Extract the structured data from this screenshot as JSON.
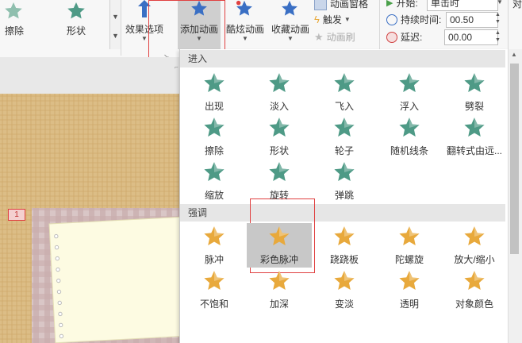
{
  "ribbon": {
    "wipe_label": "擦除",
    "shape_label": "形状",
    "effect_options_label": "效果选项",
    "add_animation_label": "添加动画",
    "cool_animation_label": "酷炫动画",
    "favorite_animation_label": "收藏动画",
    "animation_pane_label": "动画窗格",
    "trigger_label": "触发",
    "animation_painter_label": "动画刷",
    "start_label": "开始:",
    "start_value": "单击时",
    "duration_label": "持续时间:",
    "duration_value": "00.50",
    "delay_label": "延迟:",
    "delay_value": "00.00",
    "cut_label": "对"
  },
  "slide": {
    "number": "1"
  },
  "panel": {
    "entrance_header": "进入",
    "emphasis_header": "强调",
    "entrance": [
      {
        "label": "出现",
        "icon": "appear-star-icon"
      },
      {
        "label": "淡入",
        "icon": "fade-star-icon"
      },
      {
        "label": "飞入",
        "icon": "fly-in-star-icon"
      },
      {
        "label": "浮入",
        "icon": "float-in-star-icon"
      },
      {
        "label": "劈裂",
        "icon": "split-star-icon"
      },
      {
        "label": "擦除",
        "icon": "wipe-star-icon"
      },
      {
        "label": "形状",
        "icon": "shape-star-icon"
      },
      {
        "label": "轮子",
        "icon": "wheel-star-icon"
      },
      {
        "label": "随机线条",
        "icon": "random-bars-star-icon"
      },
      {
        "label": "翻转式由远...",
        "icon": "grow-turn-star-icon"
      },
      {
        "label": "缩放",
        "icon": "zoom-star-icon"
      },
      {
        "label": "旋转",
        "icon": "swivel-star-icon"
      },
      {
        "label": "弹跳",
        "icon": "bounce-star-icon"
      }
    ],
    "emphasis": [
      {
        "label": "脉冲",
        "icon": "pulse-star-icon"
      },
      {
        "label": "彩色脉冲",
        "icon": "color-pulse-star-icon"
      },
      {
        "label": "跷跷板",
        "icon": "teeter-star-icon"
      },
      {
        "label": "陀螺旋",
        "icon": "spin-star-icon"
      },
      {
        "label": "放大/缩小",
        "icon": "grow-shrink-star-icon"
      },
      {
        "label": "不饱和",
        "icon": "desaturate-star-icon"
      },
      {
        "label": "加深",
        "icon": "darken-star-icon"
      },
      {
        "label": "变淡",
        "icon": "lighten-star-icon"
      },
      {
        "label": "透明",
        "icon": "transparency-star-icon"
      },
      {
        "label": "对象颜色",
        "icon": "object-color-star-icon"
      }
    ]
  },
  "colors": {
    "entrance_green": "#4e9a86",
    "emphasis_gold": "#e8a93c",
    "selected_bg": "#c8c8c8",
    "highlight_red": "#e04040",
    "ribbon_blue": "#3a6fc4"
  }
}
